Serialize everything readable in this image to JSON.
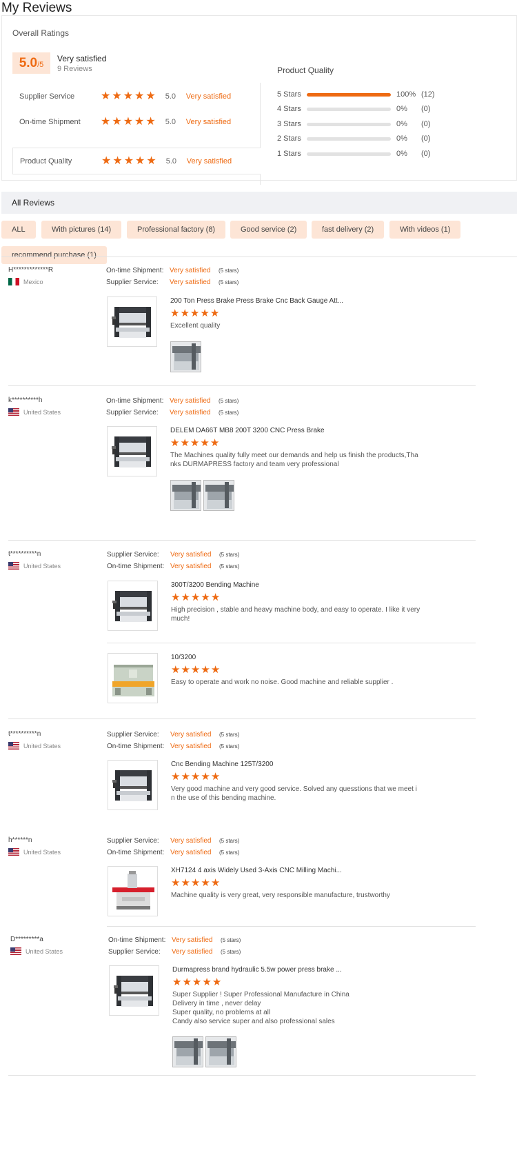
{
  "page": {
    "title": "My Reviews"
  },
  "overall": {
    "label": "Overall Ratings",
    "score": "5.0",
    "score_suffix": "/5",
    "score_text": "Very satisfied",
    "review_count": "9 Reviews",
    "sub_ratings": [
      {
        "label": "Supplier Service",
        "score": "5.0",
        "text": "Very satisfied",
        "stars": 5
      },
      {
        "label": "On-time Shipment",
        "score": "5.0",
        "text": "Very satisfied",
        "stars": 5
      },
      {
        "label": "Product Quality",
        "score": "5.0",
        "text": "Very satisfied",
        "stars": 5
      }
    ]
  },
  "product_quality": {
    "title": "Product Quality",
    "rows": [
      {
        "label": "5  Stars",
        "fraction": 1.0,
        "percent": "100%",
        "count": "(12)"
      },
      {
        "label": "4  Stars",
        "fraction": 0.0,
        "percent": "0%",
        "count": "(0)"
      },
      {
        "label": "3  Stars",
        "fraction": 0.0,
        "percent": "0%",
        "count": "(0)"
      },
      {
        "label": "2  Stars",
        "fraction": 0.0,
        "percent": "0%",
        "count": "(0)"
      },
      {
        "label": "1  Stars",
        "fraction": 0.0,
        "percent": "0%",
        "count": "(0)"
      }
    ]
  },
  "all_reviews": {
    "title": "All Reviews",
    "filters": [
      "ALL",
      "With pictures (14)",
      "Professional factory (8)",
      "Good service (2)",
      "fast delivery (2)",
      "With videos (1)",
      "recommend purchase (1)"
    ]
  },
  "reviews": [
    {
      "name": "H*************R",
      "country": "Mexico",
      "flag": "mx",
      "meta": [
        {
          "label": "On-time Shipment:",
          "value": "Very satisfied",
          "stars": "(5 stars)"
        },
        {
          "label": "Supplier Service:",
          "value": "Very satisfied",
          "stars": "(5 stars)"
        }
      ],
      "items": [
        {
          "title": "200 Ton Press Brake Press Brake Cnc Back Gauge Att...",
          "stars": 5,
          "text": [
            "Excellent quality"
          ],
          "photos": 1
        }
      ]
    },
    {
      "name": "k**********h",
      "country": "United States",
      "flag": "us",
      "meta": [
        {
          "label": "On-time Shipment:",
          "value": "Very satisfied",
          "stars": "(5 stars)"
        },
        {
          "label": "Supplier Service:",
          "value": "Very satisfied",
          "stars": "(5 stars)"
        }
      ],
      "items": [
        {
          "title": "DELEM DA66T MB8 200T 3200 CNC Press Brake",
          "stars": 5,
          "text": [
            "The Machines quality fully meet our demands and help us finish the products,Tha",
            "nks DURMAPRESS factory and team  very professional"
          ],
          "photos": 2
        }
      ]
    },
    {
      "name": "t**********n",
      "country": "United States",
      "flag": "us",
      "meta": [
        {
          "label": "Supplier Service:",
          "value": "Very satisfied",
          "stars": "(5 stars)"
        },
        {
          "label": "On-time Shipment:",
          "value": "Very satisfied",
          "stars": "(5 stars)"
        }
      ],
      "items": [
        {
          "title": "300T/3200 Bending Machine",
          "stars": 5,
          "text": [
            "High precision , stable and heavy machine body, and easy to operate. I like it very",
            "much!"
          ],
          "photos": 0
        },
        {
          "title": "10/3200",
          "stars": 5,
          "text": [
            "Easy to operate and work no noise. Good machine and reliable supplier ."
          ],
          "photos": 0
        }
      ]
    },
    {
      "name": "t**********n",
      "country": "United States",
      "flag": "us",
      "meta": [
        {
          "label": "Supplier Service:",
          "value": "Very satisfied",
          "stars": "(5 stars)"
        },
        {
          "label": "On-time Shipment:",
          "value": "Very satisfied",
          "stars": "(5 stars)"
        }
      ],
      "items": [
        {
          "title": "Cnc Bending Machine 125T/3200",
          "stars": 5,
          "text": [
            "Very good machine and very good service.  Solved any quesstions that we meet i",
            "n the use of this bending machine."
          ],
          "photos": 0
        }
      ]
    },
    {
      "name": "h******n",
      "country": "United States",
      "flag": "us",
      "meta": [
        {
          "label": "Supplier Service:",
          "value": "Very satisfied",
          "stars": "(5 stars)"
        },
        {
          "label": "On-time Shipment:",
          "value": "Very satisfied",
          "stars": "(5 stars)"
        }
      ],
      "items": [
        {
          "title": "XH7124 4 axis Widely Used 3-Axis CNC Milling Machi...",
          "stars": 5,
          "text": [
            "Machine quality is very great, very responsible manufacture,    trustworthy"
          ],
          "photos": 0
        }
      ]
    },
    {
      "name": "D*********a",
      "country": "United States",
      "flag": "us",
      "meta": [
        {
          "label": "On-time Shipment:",
          "value": "Very satisfied",
          "stars": "(5 stars)"
        },
        {
          "label": "Supplier Service:",
          "value": "Very satisfied",
          "stars": "(5 stars)"
        }
      ],
      "items": [
        {
          "title": "Durmapress brand hydraulic 5.5w power press brake ...",
          "stars": 5,
          "text": [
            "Super Supplier ! Super Professional Manufacture in China",
            "Delivery in time , never delay",
            "Super quality, no problems at all",
            "Candy also service super and also professional sales"
          ],
          "photos": 2
        }
      ]
    }
  ],
  "colors": {
    "accent": "#ee6a12",
    "badge_bg": "#fde5d6",
    "section_bg": "#f0f1f4"
  }
}
